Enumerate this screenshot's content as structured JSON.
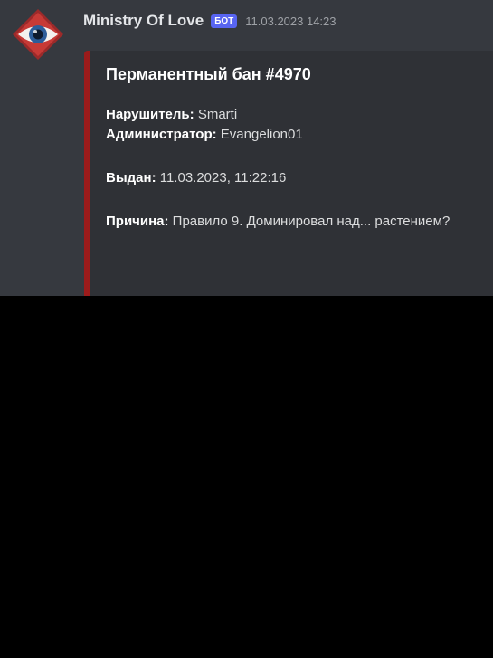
{
  "message": {
    "author": "Ministry Of Love",
    "bot_tag": "БОТ",
    "timestamp": "11.03.2023 14:23"
  },
  "embed": {
    "title": "Перманентный бан #4970",
    "accent_color": "#9b1b1b",
    "fields": {
      "violator_label": "Нарушитель:",
      "violator_value": "Smarti",
      "admin_label": "Администратор:",
      "admin_value": "Evangelion01",
      "issued_label": "Выдан:",
      "issued_value": "11.03.2023, 11:22:16",
      "reason_label": "Причина:",
      "reason_value": "Правило 9. Доминировал над... растением?"
    }
  },
  "colors": {
    "background": "#36393f",
    "embed_background": "#2f3136",
    "bot_tag": "#5865f2"
  },
  "icons": {
    "avatar": "eye-icon"
  }
}
